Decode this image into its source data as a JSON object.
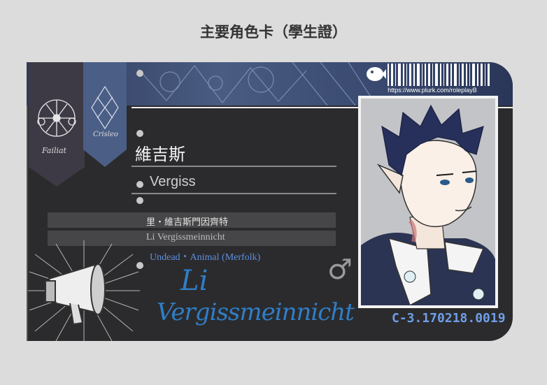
{
  "page": {
    "title": "主要角色卡（學生證）"
  },
  "card": {
    "url": "https://www.plurk.com/roleplayB",
    "name_zh": "維吉斯",
    "name_en": "Vergiss",
    "full_name_zh": "里・維吉斯門因齊特",
    "full_name_en": "Li Vergissmeinnicht",
    "race": "Undead・Animal (Merfolk)",
    "gender_symbol": "♂",
    "signature_line1": "Li",
    "signature_line2": "Vergissmeinnicht",
    "serial": "C-3.170218.0019",
    "tab_left_label": "Failiat",
    "tab_right_label": "Crisleo",
    "icons": [
      "zodiac-emblem-icon",
      "megaphone-icon",
      "fish-logo-icon",
      "barcode-icon"
    ],
    "colors": {
      "band": "#3a4a70",
      "card": "#2b2b2d",
      "accent_blue": "#5d8fe0",
      "serial_blue": "#6f9fe6"
    }
  }
}
